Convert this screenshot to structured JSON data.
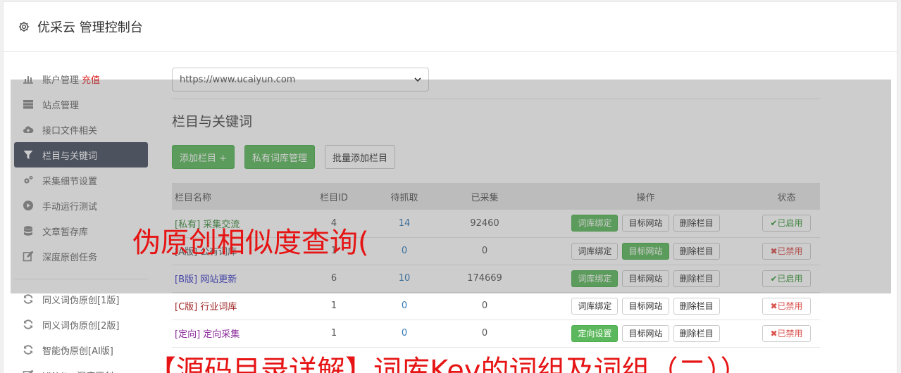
{
  "header": {
    "title": "优采云 管理控制台"
  },
  "sidebar": {
    "items": [
      {
        "label": "账户管理",
        "extra": "充值",
        "icon": "bar-chart-icon"
      },
      {
        "label": "站点管理",
        "icon": "server-icon"
      },
      {
        "label": "接口文件相关",
        "icon": "cloud-upload-icon"
      },
      {
        "label": "栏目与关键词",
        "icon": "filter-icon",
        "active": true
      },
      {
        "label": "采集细节设置",
        "icon": "cogs-icon"
      },
      {
        "label": "手动运行测试",
        "icon": "play-circle-icon"
      },
      {
        "label": "文章暂存库",
        "icon": "database-icon"
      },
      {
        "label": "深度原创任务",
        "icon": "edit-icon"
      }
    ],
    "items2": [
      {
        "label": "同义词伪原创[1版]",
        "icon": "refresh-icon"
      },
      {
        "label": "同义词伪原创[2版]",
        "icon": "refresh-icon"
      },
      {
        "label": "智能伪原创[AI版]",
        "icon": "refresh-icon"
      },
      {
        "label": "UWriter深度原创",
        "icon": "edit-icon"
      }
    ]
  },
  "site_select": {
    "value": "https://www.ucaiyun.com"
  },
  "section": {
    "title": "栏目与关键词"
  },
  "toolbar": {
    "add_label": "添加栏目 +",
    "private_label": "私有词库管理",
    "batch_label": "批量添加栏目"
  },
  "table": {
    "headers": {
      "name": "栏目名称",
      "id": "栏目ID",
      "pending": "待抓取",
      "collected": "已采集",
      "ops": "操作",
      "status": "状态"
    },
    "rows": [
      {
        "name": "[私有] 采集交流",
        "name_color": "#3c8a3c",
        "id": "4",
        "pending": "14",
        "collected": "92460",
        "op1": "词库绑定",
        "op1_green": true,
        "op2": "目标网站",
        "op2_green": false,
        "op3": "删除栏目",
        "status": "✔已启用",
        "enabled": true
      },
      {
        "name": "[A版] 公有词库",
        "name_color": "#555555",
        "id": "1",
        "pending": "0",
        "collected": "0",
        "op1": "词库绑定",
        "op1_green": false,
        "op2": "目标网站",
        "op2_green": true,
        "op3": "删除栏目",
        "status": "✖已禁用",
        "enabled": false
      },
      {
        "name": "[B版] 网站更新",
        "name_color": "#3a3ac8",
        "id": "6",
        "pending": "10",
        "collected": "174669",
        "op1": "词库绑定",
        "op1_green": true,
        "op2": "目标网站",
        "op2_green": false,
        "op3": "删除栏目",
        "status": "✔已启用",
        "enabled": true
      },
      {
        "name": "[C版] 行业词库",
        "name_color": "#a02828",
        "id": "1",
        "pending": "0",
        "collected": "0",
        "op1": "词库绑定",
        "op1_green": false,
        "op2": "目标网站",
        "op2_green": false,
        "op3": "删除栏目",
        "status": "✖已禁用",
        "enabled": false
      },
      {
        "name": "[定向] 定向采集",
        "name_color": "#8a2a9a",
        "id": "1",
        "pending": "0",
        "collected": "0",
        "op1": "定向设置",
        "op1_green": true,
        "op2": "目标网站",
        "op2_green": false,
        "op3": "删除栏目",
        "status": "✖已禁用",
        "enabled": false
      }
    ]
  },
  "watermark": {
    "line1": "伪原创相似度查询(",
    "line2": "【源码目录详解】词库Key的词组及词组（二））"
  },
  "colors": {
    "accent_green": "#5cb85c",
    "sidebar_active": "#474f60",
    "watermark_red": "#e61414"
  }
}
